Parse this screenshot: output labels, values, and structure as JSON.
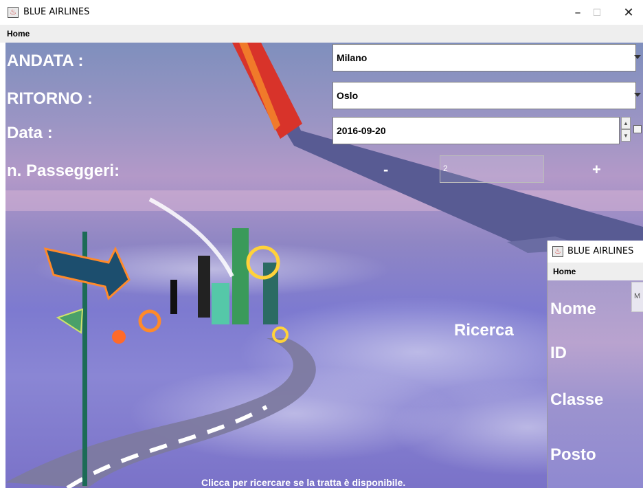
{
  "window": {
    "title": "BLUE AIRLINES",
    "app_icon": "java-cup-icon",
    "minimize": "–",
    "maximize": "☐",
    "close": "✕"
  },
  "menubar": {
    "home": "Home"
  },
  "form": {
    "andata_label": "ANDATA :",
    "andata_value": "Milano",
    "ritorno_label": "RITORNO :",
    "ritorno_value": "Oslo",
    "data_label": "Data :",
    "data_value": "2016-09-20",
    "passeggeri_label": "n. Passeggeri:",
    "minus": "-",
    "passengers_value": "2",
    "plus": "+",
    "search_label": "Ricerca",
    "status_text": "Clicca per ricercare se la tratta è disponibile."
  },
  "sub_window": {
    "title": "BLUE AIRLINES",
    "menu_home": "Home",
    "nome_label": "Nome",
    "nome_value": "M",
    "id_label": "ID",
    "classe_label": "Classe",
    "posto_label": "Posto"
  },
  "colors": {
    "sky_top": "#7f8fbd",
    "sky_mid": "#b399c8",
    "sky_bottom": "#7a72c8",
    "wing": "#5a5fa0",
    "tail_red": "#d8332a"
  }
}
